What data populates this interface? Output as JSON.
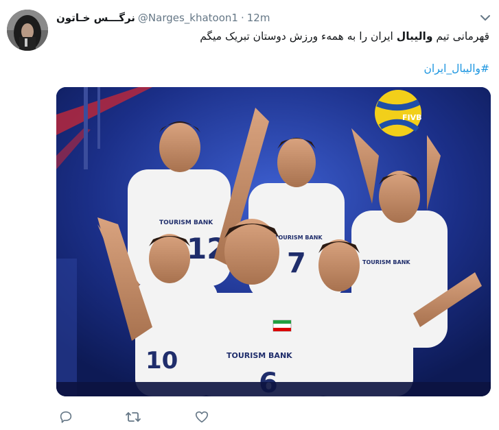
{
  "tweet": {
    "display_name": "نرگـــس خـاتون",
    "handle": "@Narges_khatoon1",
    "separator": "·",
    "time": "12m",
    "text_before_bold": "قهرمانی تیم ",
    "text_bold": "والیبال",
    "text_after_bold": " ایران را به همهء ورزش دوستان تبریک میگم",
    "hashtag": "#والیبال_ایران",
    "icons": {
      "caret": "chevron-down-icon",
      "reply": "reply-icon",
      "retweet": "retweet-icon",
      "like": "heart-icon"
    },
    "jersey_sponsor": "TOURISM BANK",
    "jersey_numbers": [
      "12",
      "7",
      "4",
      "6",
      "10"
    ],
    "colors": {
      "link": "#1b95e0",
      "muted": "#657786",
      "text": "#14171a",
      "media_bg": "#12246b"
    }
  }
}
